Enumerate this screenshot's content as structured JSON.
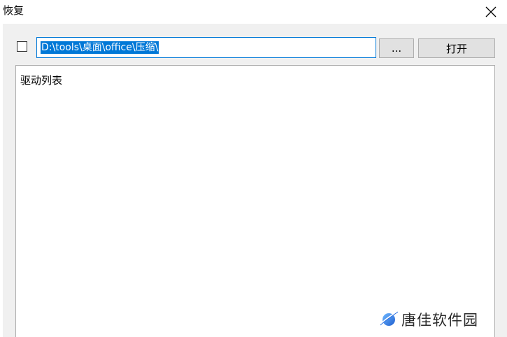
{
  "window": {
    "title": "恢复"
  },
  "toolbar": {
    "path_value": "D:\\tools\\桌面\\office\\压缩\\",
    "browse_label": "...",
    "open_label": "打开"
  },
  "drive_list": {
    "header": "驱动列表"
  },
  "watermark": {
    "text": "唐佳软件园"
  },
  "icons": {
    "close": "close-icon",
    "watermark_logo": "planet-logo-icon"
  },
  "colors": {
    "accent": "#0078d7",
    "button_bg": "#e1e1e1",
    "window_bg": "#f0f0f0"
  }
}
